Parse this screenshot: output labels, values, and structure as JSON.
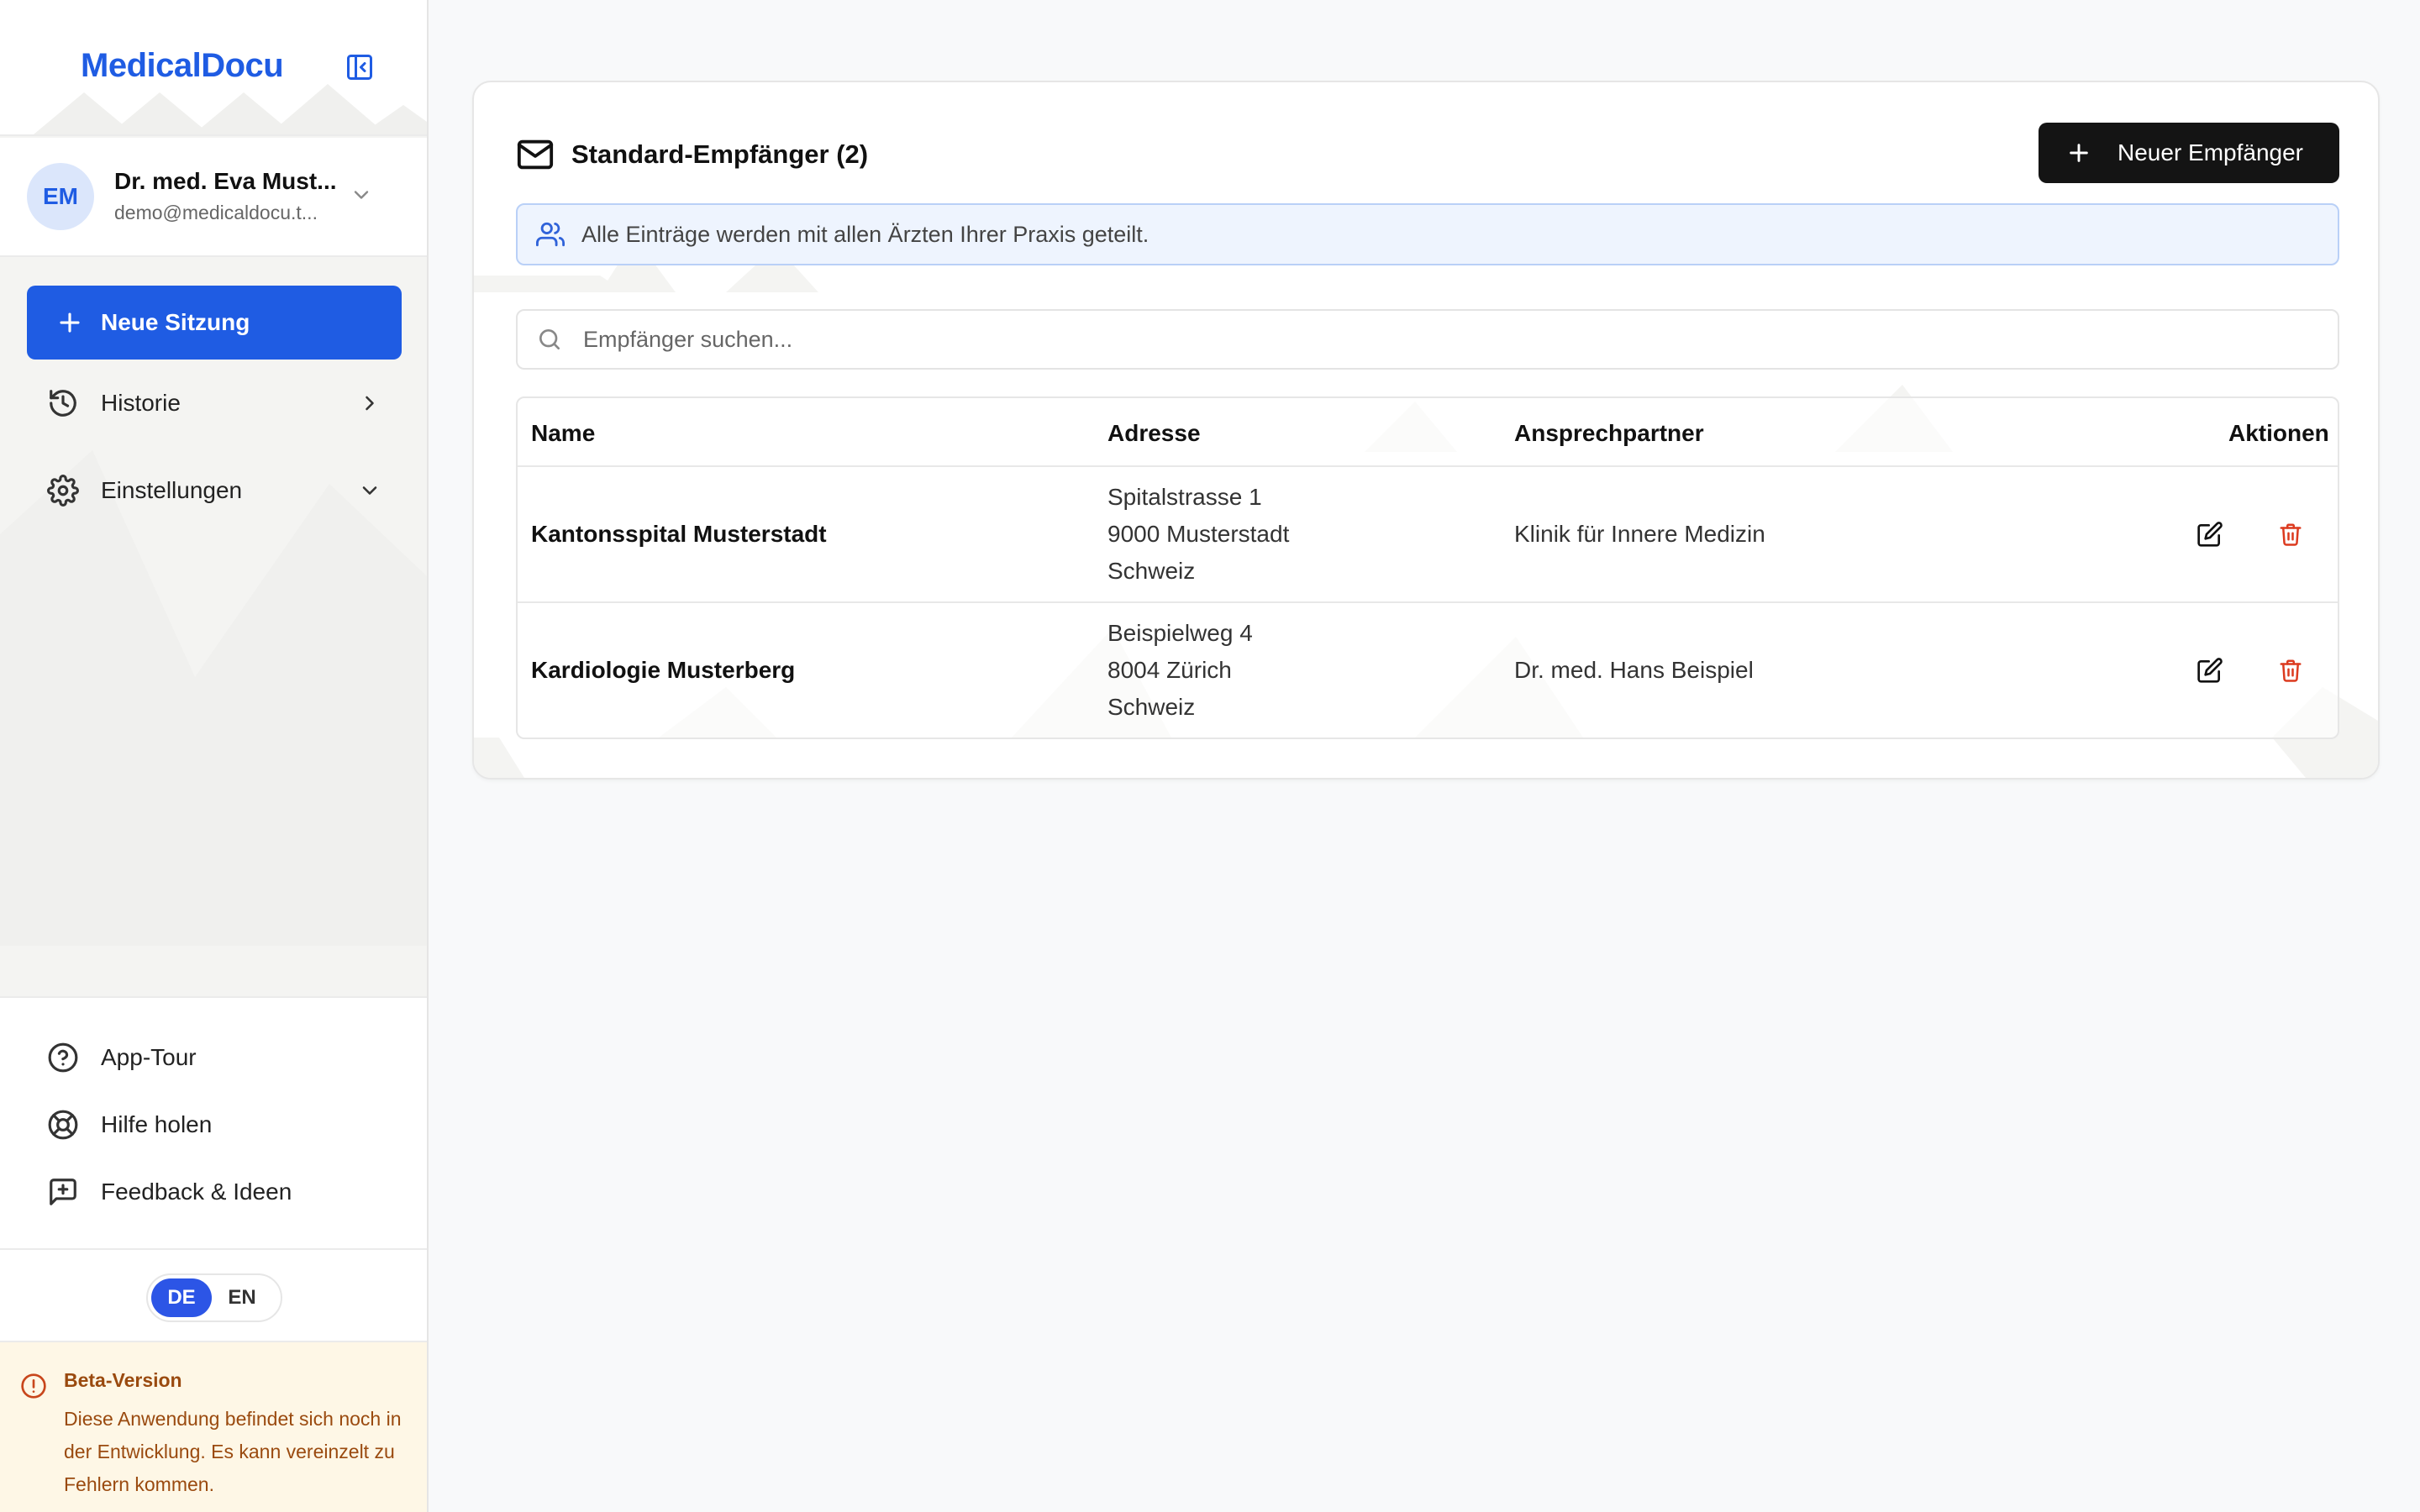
{
  "app": {
    "logo": "MedicalDocu"
  },
  "user": {
    "initials": "EM",
    "name": "Dr. med. Eva Must...",
    "email": "demo@medicaldocu.t..."
  },
  "nav": {
    "new_session": "Neue Sitzung",
    "history": "Historie",
    "settings": "Einstellungen"
  },
  "bottom_links": {
    "tour": "App-Tour",
    "help": "Hilfe holen",
    "feedback": "Feedback & Ideen"
  },
  "language": {
    "options": [
      "DE",
      "EN"
    ],
    "selected": "DE"
  },
  "beta": {
    "title": "Beta-Version",
    "text": "Diese Anwendung befindet sich noch in der Entwicklung. Es kann vereinzelt zu Fehlern kommen."
  },
  "recipients": {
    "title": "Standard-Empfänger (2)",
    "new_button": "Neuer Empfänger",
    "info": "Alle Einträge werden mit allen Ärzten Ihrer Praxis geteilt.",
    "search_placeholder": "Empfänger suchen...",
    "columns": {
      "name": "Name",
      "address": "Adresse",
      "contact": "Ansprechpartner",
      "actions": "Aktionen"
    },
    "rows": [
      {
        "name": "Kantonsspital Musterstadt",
        "address": [
          "Spitalstrasse 1",
          "9000 Musterstadt",
          "Schweiz"
        ],
        "contact": "Klinik für Innere Medizin"
      },
      {
        "name": "Kardiologie Musterberg",
        "address": [
          "Beispielweg 4",
          "8004 Zürich",
          "Schweiz"
        ],
        "contact": "Dr. med. Hans Beispiel"
      }
    ]
  },
  "colors": {
    "brand": "#1f5ce3",
    "dark_button": "#141414",
    "danger": "#dc3a1f",
    "beta_bg": "#fef7e6"
  },
  "icons": {
    "collapse": "sidebar-collapse-icon",
    "history": "history-icon",
    "settings": "gear-icon",
    "mail": "mail-icon",
    "users": "users-icon",
    "search": "search-icon",
    "edit": "edit-icon",
    "delete": "trash-icon"
  }
}
